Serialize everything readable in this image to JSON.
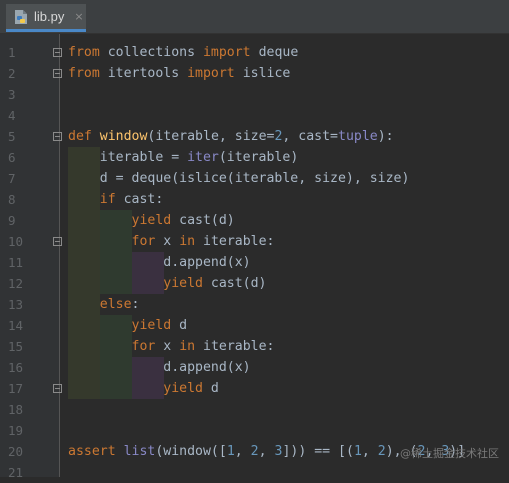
{
  "tab": {
    "filename": "lib.py",
    "close_glyph": "×",
    "icon": "python-file-icon"
  },
  "colors": {
    "keyword": "#cc7832",
    "function": "#ffc66d",
    "number": "#6897bb",
    "builtin": "#8888c6",
    "text": "#a9b7c6",
    "background": "#2b2b2b"
  },
  "lines": [
    {
      "n": "1",
      "tokens": [
        [
          "from",
          "kw"
        ],
        [
          " collections ",
          "p"
        ],
        [
          "import",
          "kw"
        ],
        [
          " deque",
          "p"
        ]
      ]
    },
    {
      "n": "2",
      "tokens": [
        [
          "from",
          "kw"
        ],
        [
          " itertools ",
          "p"
        ],
        [
          "import",
          "kw"
        ],
        [
          " islice",
          "p"
        ]
      ]
    },
    {
      "n": "3",
      "tokens": []
    },
    {
      "n": "4",
      "tokens": []
    },
    {
      "n": "5",
      "tokens": [
        [
          "def",
          "kw"
        ],
        [
          " ",
          "p"
        ],
        [
          "window",
          "fn"
        ],
        [
          "(iterable, size=",
          "p"
        ],
        [
          "2",
          "num"
        ],
        [
          ", cast=",
          "p"
        ],
        [
          "tuple",
          "bi"
        ],
        [
          "):",
          "p"
        ]
      ]
    },
    {
      "n": "6",
      "tokens": [
        [
          "    iterable = ",
          "p"
        ],
        [
          "iter",
          "bi"
        ],
        [
          "(iterable)",
          "p"
        ]
      ]
    },
    {
      "n": "7",
      "tokens": [
        [
          "    d = deque(islice(iterable, size), size)",
          "p"
        ]
      ]
    },
    {
      "n": "8",
      "tokens": [
        [
          "    ",
          "p"
        ],
        [
          "if",
          "kw"
        ],
        [
          " cast:",
          "p"
        ]
      ]
    },
    {
      "n": "9",
      "tokens": [
        [
          "        ",
          "p"
        ],
        [
          "yield",
          "kw"
        ],
        [
          " cast(d)",
          "p"
        ]
      ]
    },
    {
      "n": "10",
      "tokens": [
        [
          "        ",
          "p"
        ],
        [
          "for",
          "kw"
        ],
        [
          " x ",
          "p"
        ],
        [
          "in",
          "kw"
        ],
        [
          " iterable:",
          "p"
        ]
      ]
    },
    {
      "n": "11",
      "tokens": [
        [
          "            d.append(x)",
          "p"
        ]
      ]
    },
    {
      "n": "12",
      "tokens": [
        [
          "            ",
          "p"
        ],
        [
          "yield",
          "kw"
        ],
        [
          " cast(d)",
          "p"
        ]
      ]
    },
    {
      "n": "13",
      "tokens": [
        [
          "    ",
          "p"
        ],
        [
          "else",
          "kw"
        ],
        [
          ":",
          "p"
        ]
      ]
    },
    {
      "n": "14",
      "tokens": [
        [
          "        ",
          "p"
        ],
        [
          "yield",
          "kw"
        ],
        [
          " d",
          "p"
        ]
      ]
    },
    {
      "n": "15",
      "tokens": [
        [
          "        ",
          "p"
        ],
        [
          "for",
          "kw"
        ],
        [
          " x ",
          "p"
        ],
        [
          "in",
          "kw"
        ],
        [
          " iterable:",
          "p"
        ]
      ]
    },
    {
      "n": "16",
      "tokens": [
        [
          "            d.append(x)",
          "p"
        ]
      ]
    },
    {
      "n": "17",
      "tokens": [
        [
          "            ",
          "p"
        ],
        [
          "yield",
          "kw"
        ],
        [
          " d",
          "p"
        ]
      ]
    },
    {
      "n": "18",
      "tokens": []
    },
    {
      "n": "19",
      "tokens": []
    },
    {
      "n": "20",
      "tokens": [
        [
          "assert",
          "kw"
        ],
        [
          " ",
          "p"
        ],
        [
          "list",
          "bi"
        ],
        [
          "(window([",
          "p"
        ],
        [
          "1",
          "num"
        ],
        [
          ", ",
          "p"
        ],
        [
          "2",
          "num"
        ],
        [
          ", ",
          "p"
        ],
        [
          "3",
          "num"
        ],
        [
          "])) == [(",
          "p"
        ],
        [
          "1",
          "num"
        ],
        [
          ", ",
          "p"
        ],
        [
          "2",
          "num"
        ],
        [
          "), (",
          "p"
        ],
        [
          "2",
          "num"
        ],
        [
          ", ",
          "p"
        ],
        [
          "3",
          "num"
        ],
        [
          ")]",
          "p"
        ]
      ]
    },
    {
      "n": "21",
      "tokens": []
    }
  ],
  "watermark": "@稀土掘金技术社区"
}
